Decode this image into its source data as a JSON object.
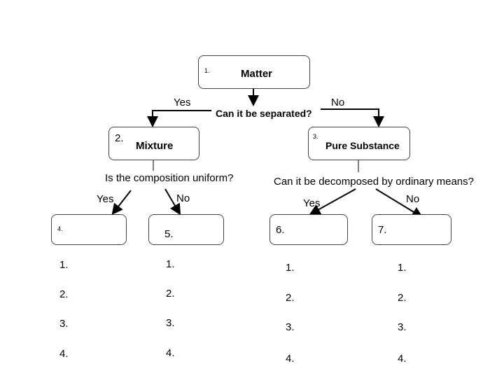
{
  "nodes": {
    "matter": {
      "number": "1.",
      "label": "Matter"
    },
    "mixture": {
      "number": "2.",
      "label": "Mixture"
    },
    "pure_substance": {
      "number": "3.",
      "label": "Pure Substance"
    },
    "box4": {
      "number": "4."
    },
    "box5": {
      "number": "5."
    },
    "box6": {
      "number": "6."
    },
    "box7": {
      "number": "7."
    }
  },
  "questions": {
    "separated": "Can it be separated?",
    "uniform": "Is the composition uniform?",
    "decomposed": "Can it be decomposed by ordinary means?"
  },
  "branches": {
    "separated_yes": "Yes",
    "separated_no": "No",
    "uniform_yes": "Yes",
    "uniform_no": "No",
    "decomposed_yes": "Yes",
    "decomposed_no": "No"
  },
  "lists": [
    [
      "1.",
      "2.",
      "3.",
      "4."
    ],
    [
      "1.",
      "2.",
      "3.",
      "4."
    ],
    [
      "1.",
      "2.",
      "3.",
      "4."
    ],
    [
      "1.",
      "2.",
      "3.",
      "4."
    ]
  ]
}
